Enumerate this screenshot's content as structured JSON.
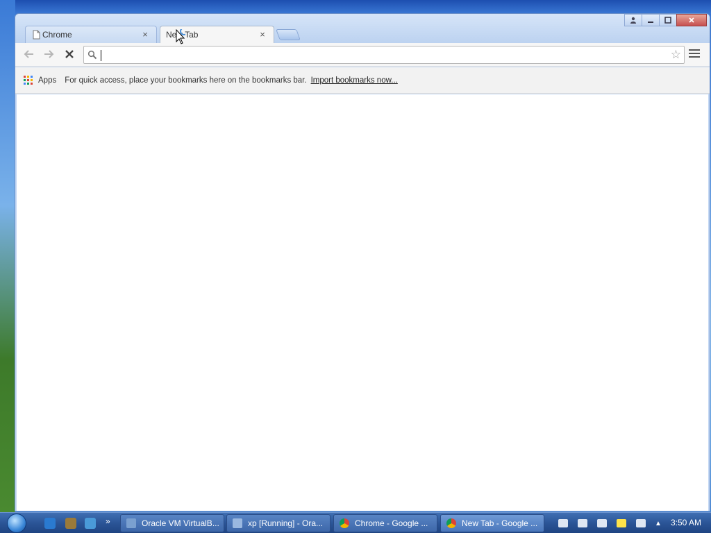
{
  "tabs": [
    {
      "title": "Chrome",
      "active": false
    },
    {
      "title": "New Tab",
      "active": true
    }
  ],
  "omnibox": {
    "value": "",
    "placeholder": ""
  },
  "bookmarks_bar": {
    "apps_label": "Apps",
    "message": "For quick access, place your bookmarks here on the bookmarks bar.",
    "import_link": "Import bookmarks now..."
  },
  "taskbar": {
    "buttons": [
      {
        "label": "Oracle VM VirtualB...",
        "icon": "virtualbox-icon"
      },
      {
        "label": "xp [Running] - Ora...",
        "icon": "vm-running-icon"
      },
      {
        "label": "Chrome - Google ...",
        "icon": "chrome-icon"
      },
      {
        "label": "New Tab - Google ...",
        "icon": "chrome-icon"
      }
    ],
    "overflow": "»",
    "clock": "3:50 AM"
  },
  "colors": {
    "chrome_red": "#db4437",
    "chrome_yellow": "#f4b400",
    "chrome_green": "#0f9d58",
    "chrome_blue": "#4285f4"
  }
}
